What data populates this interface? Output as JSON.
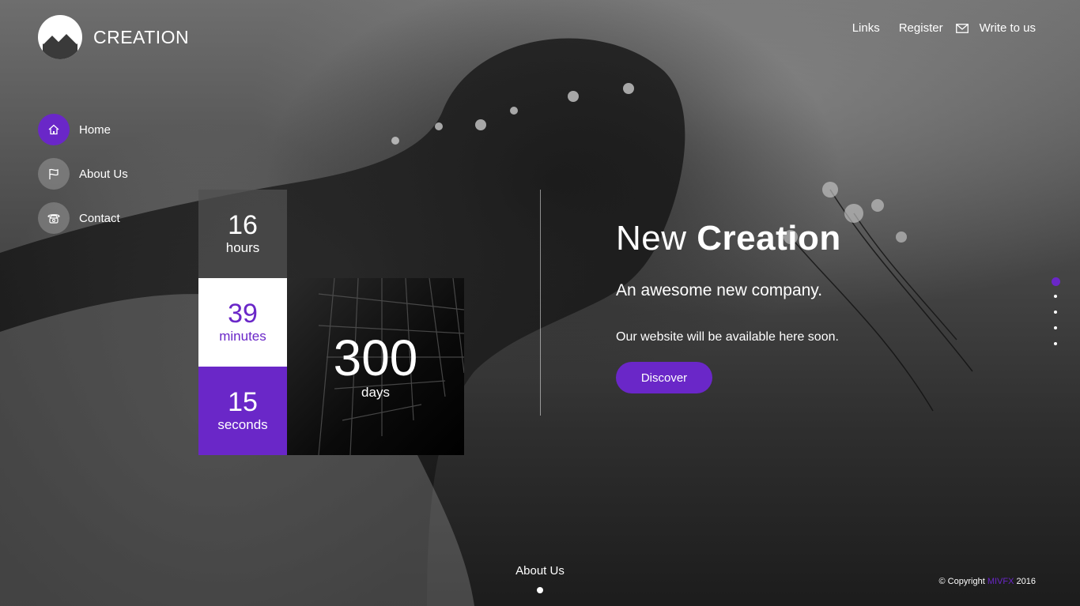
{
  "brand": {
    "name": "CREATION"
  },
  "topnav": {
    "links_label": "Links",
    "register_label": "Register",
    "write_label": "Write to us"
  },
  "sidenav": {
    "items": [
      {
        "label": "Home",
        "icon": "home-icon",
        "active": true
      },
      {
        "label": "About Us",
        "icon": "flag-icon",
        "active": false
      },
      {
        "label": "Contact",
        "icon": "phone-icon",
        "active": false
      }
    ]
  },
  "countdown": {
    "hours": {
      "value": "16",
      "unit": "hours"
    },
    "minutes": {
      "value": "39",
      "unit": "minutes"
    },
    "seconds": {
      "value": "15",
      "unit": "seconds"
    },
    "days": {
      "value": "300",
      "unit": "days"
    }
  },
  "hero": {
    "title_light": "New",
    "title_bold": "Creation",
    "subtitle": "An awesome new company.",
    "description": "Our website will be available here soon.",
    "button_label": "Discover"
  },
  "pager": {
    "count": 5,
    "active_index": 0
  },
  "bottom": {
    "about_label": "About Us"
  },
  "footer": {
    "copyright_prefix": "© Copyright",
    "copyright_brand": "MIVFX",
    "copyright_year": "2016"
  },
  "colors": {
    "accent": "#6a27c8",
    "text": "#ffffff"
  }
}
